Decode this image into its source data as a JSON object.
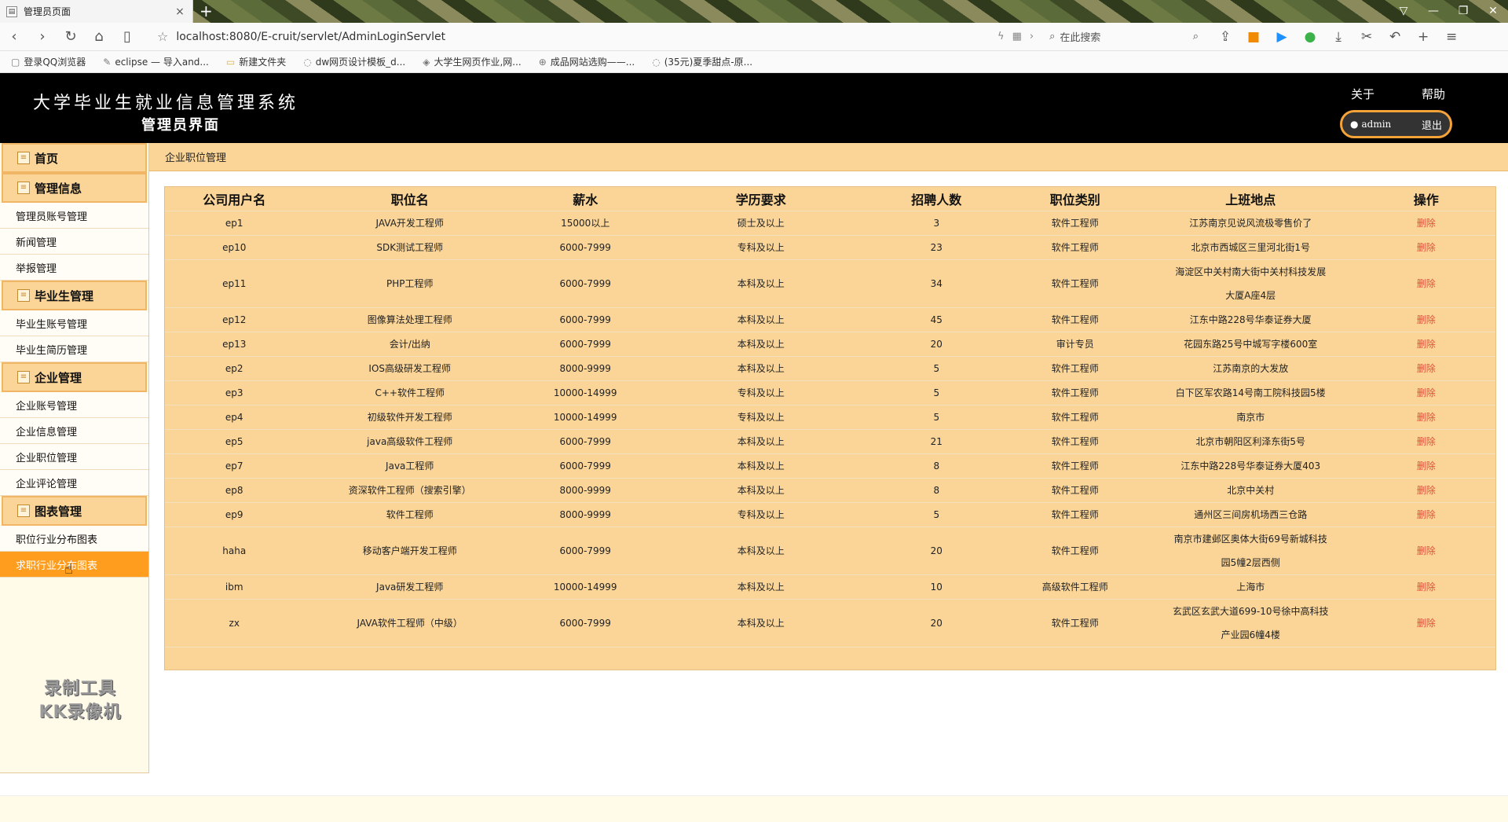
{
  "browser": {
    "tab_title": "管理员页面",
    "url": "localhost:8080/E-cruit/servlet/AdminLoginServlet",
    "search_placeholder": "在此搜索",
    "bookmarks": [
      "登录QQ浏览器",
      "eclipse — 导入and...",
      "新建文件夹",
      "dw网页设计模板_d...",
      "大学生网页作业,网...",
      "成品网站选购——...",
      "(35元)夏季甜点-原..."
    ]
  },
  "header": {
    "system_title": "大学毕业生就业信息管理系统",
    "sub_title": "管理员界面",
    "about": "关于",
    "help": "帮助",
    "username": "admin",
    "logout": "退出"
  },
  "sidebar": {
    "home": "首页",
    "sections": [
      {
        "title": "管理信息",
        "items": [
          "管理员账号管理",
          "新闻管理",
          "举报管理"
        ]
      },
      {
        "title": "毕业生管理",
        "items": [
          "毕业生账号管理",
          "毕业生简历管理"
        ]
      },
      {
        "title": "企业管理",
        "items": [
          "企业账号管理",
          "企业信息管理",
          "企业职位管理",
          "企业评论管理"
        ]
      },
      {
        "title": "图表管理",
        "items": [
          "职位行业分布图表",
          "求职行业分布图表"
        ]
      }
    ],
    "watermark_line1": "录制工具",
    "watermark_line2": "KK录像机"
  },
  "main": {
    "breadcrumb": "企业职位管理",
    "columns": [
      "公司用户名",
      "职位名",
      "薪水",
      "学历要求",
      "招聘人数",
      "职位类别",
      "上班地点",
      "操作"
    ],
    "rows": [
      [
        "ep1",
        "JAVA开发工程师",
        "15000以上",
        "硕士及以上",
        "3",
        "软件工程师",
        "江苏南京见说风流极零售价了",
        "删除"
      ],
      [
        "ep10",
        "SDK测试工程师",
        "6000-7999",
        "专科及以上",
        "23",
        "软件工程师",
        "北京市西城区三里河北街1号",
        "删除"
      ],
      [
        "ep11",
        "PHP工程师",
        "6000-7999",
        "本科及以上",
        "34",
        "软件工程师",
        "海淀区中关村南大街中关村科技发展大厦A座4层",
        "删除"
      ],
      [
        "ep12",
        "图像算法处理工程师",
        "6000-7999",
        "本科及以上",
        "45",
        "软件工程师",
        "江东中路228号华泰证券大厦",
        "删除"
      ],
      [
        "ep13",
        "会计/出纳",
        "6000-7999",
        "本科及以上",
        "20",
        "审计专员",
        "花园东路25号中城写字楼600室",
        "删除"
      ],
      [
        "ep2",
        "IOS高级研发工程师",
        "8000-9999",
        "本科及以上",
        "5",
        "软件工程师",
        "江苏南京的大发放",
        "删除"
      ],
      [
        "ep3",
        "C++软件工程师",
        "10000-14999",
        "专科及以上",
        "5",
        "软件工程师",
        "白下区军农路14号南工院科技园5楼",
        "删除"
      ],
      [
        "ep4",
        "初级软件开发工程师",
        "10000-14999",
        "专科及以上",
        "5",
        "软件工程师",
        "南京市",
        "删除"
      ],
      [
        "ep5",
        "java高级软件工程师",
        "6000-7999",
        "本科及以上",
        "21",
        "软件工程师",
        "北京市朝阳区利泽东街5号",
        "删除"
      ],
      [
        "ep7",
        "Java工程师",
        "6000-7999",
        "本科及以上",
        "8",
        "软件工程师",
        "江东中路228号华泰证券大厦403",
        "删除"
      ],
      [
        "ep8",
        "资深软件工程师（搜索引擎）",
        "8000-9999",
        "本科及以上",
        "8",
        "软件工程师",
        "北京中关村",
        "删除"
      ],
      [
        "ep9",
        "软件工程师",
        "8000-9999",
        "专科及以上",
        "5",
        "软件工程师",
        "通州区三间房机场西三仓路",
        "删除"
      ],
      [
        "haha",
        "移动客户端开发工程师",
        "6000-7999",
        "本科及以上",
        "20",
        "软件工程师",
        "南京市建邺区奥体大街69号新城科技园5幢2层西侧",
        "删除"
      ],
      [
        "ibm",
        "Java研发工程师",
        "10000-14999",
        "本科及以上",
        "10",
        "高级软件工程师",
        "上海市",
        "删除"
      ],
      [
        "zx",
        "JAVA软件工程师（中级）",
        "6000-7999",
        "本科及以上",
        "20",
        "软件工程师",
        "玄武区玄武大道699-10号徐中高科技产业园6幢4楼",
        "删除"
      ]
    ]
  }
}
